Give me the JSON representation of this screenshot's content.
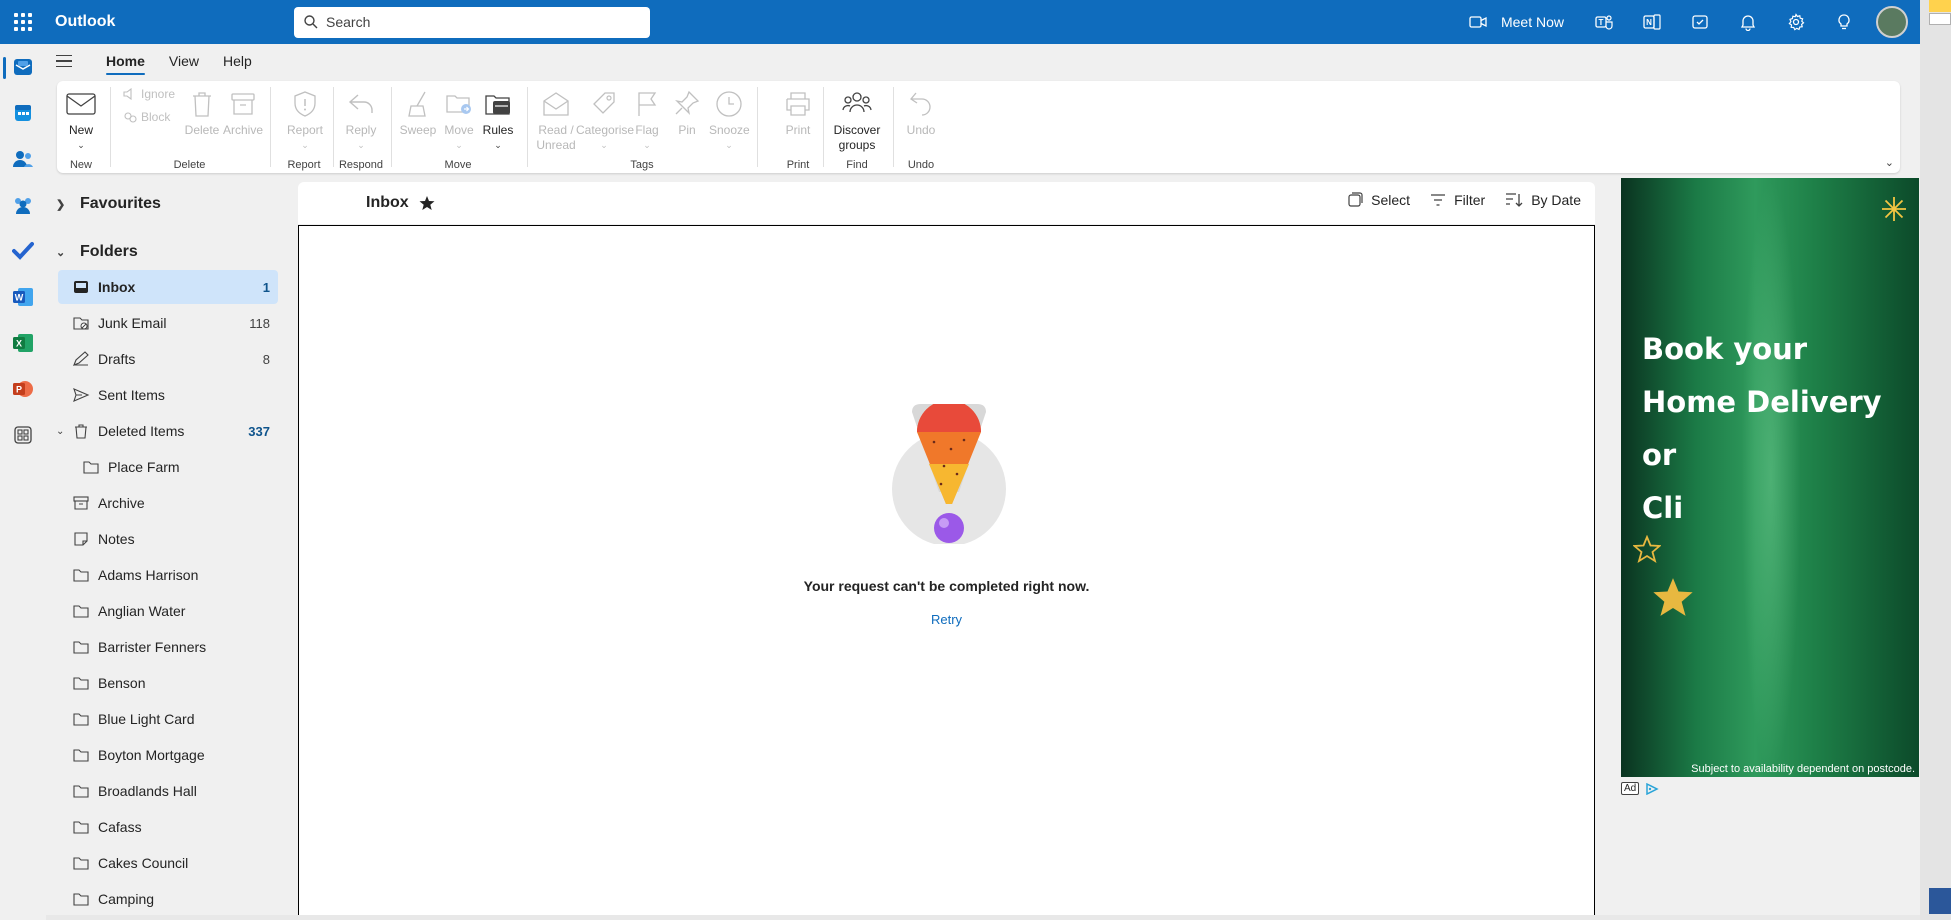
{
  "app": {
    "title": "Outlook"
  },
  "search": {
    "placeholder": "Search"
  },
  "topbar": {
    "meet_now": "Meet Now"
  },
  "tabs": [
    {
      "label": "Home",
      "active": true
    },
    {
      "label": "View",
      "active": false
    },
    {
      "label": "Help",
      "active": false
    }
  ],
  "ribbon": {
    "new": "New",
    "ignore": "Ignore",
    "block": "Block",
    "delete": "Delete",
    "archive": "Archive",
    "report": "Report",
    "reply": "Reply",
    "sweep": "Sweep",
    "move": "Move",
    "rules": "Rules",
    "read_unread_1": "Read /",
    "read_unread_2": "Unread",
    "categorise": "Categorise",
    "flag": "Flag",
    "pin": "Pin",
    "snooze": "Snooze",
    "print": "Print",
    "discover_1": "Discover",
    "discover_2": "groups",
    "undo": "Undo",
    "groups": {
      "new": "New",
      "delete": "Delete",
      "report": "Report",
      "respond": "Respond",
      "move": "Move",
      "tags": "Tags",
      "print": "Print",
      "find": "Find",
      "undo": "Undo"
    }
  },
  "folders": {
    "favourites": "Favourites",
    "folders": "Folders",
    "items": [
      {
        "name": "Inbox",
        "count": "1",
        "icon": "inbox-icon"
      },
      {
        "name": "Junk Email",
        "count": "118",
        "icon": "junk-icon"
      },
      {
        "name": "Drafts",
        "count": "8",
        "icon": "drafts-icon"
      },
      {
        "name": "Sent Items",
        "count": "",
        "icon": "sent-icon"
      },
      {
        "name": "Deleted Items",
        "count": "337",
        "icon": "trash-icon"
      },
      {
        "name": "Place Farm",
        "count": "",
        "icon": "folder-icon"
      },
      {
        "name": "Archive",
        "count": "",
        "icon": "archive-icon"
      },
      {
        "name": "Notes",
        "count": "",
        "icon": "notes-icon"
      },
      {
        "name": "Adams Harrison",
        "count": "",
        "icon": "folder-icon"
      },
      {
        "name": "Anglian Water",
        "count": "",
        "icon": "folder-icon"
      },
      {
        "name": "Barrister Fenners",
        "count": "",
        "icon": "folder-icon"
      },
      {
        "name": "Benson",
        "count": "",
        "icon": "folder-icon"
      },
      {
        "name": "Blue Light Card",
        "count": "",
        "icon": "folder-icon"
      },
      {
        "name": "Boyton Mortgage",
        "count": "",
        "icon": "folder-icon"
      },
      {
        "name": "Broadlands Hall",
        "count": "",
        "icon": "folder-icon"
      },
      {
        "name": "Cafass",
        "count": "",
        "icon": "folder-icon"
      },
      {
        "name": "Cakes Council",
        "count": "",
        "icon": "folder-icon"
      },
      {
        "name": "Camping",
        "count": "",
        "icon": "folder-icon"
      }
    ]
  },
  "list": {
    "title": "Inbox",
    "select": "Select",
    "filter": "Filter",
    "sort": "By Date",
    "error": "Your request can't be completed right now.",
    "retry": "Retry"
  },
  "ad": {
    "line1": "Book your",
    "line2": "Home Delivery or",
    "line3": "Cli",
    "footnote": "Subject to availability dependent on postcode.",
    "badge": "Ad"
  },
  "colors": {
    "brand": "#0f6cbd",
    "selected": "#cfe4fa",
    "count_accent": "#0f548c"
  }
}
